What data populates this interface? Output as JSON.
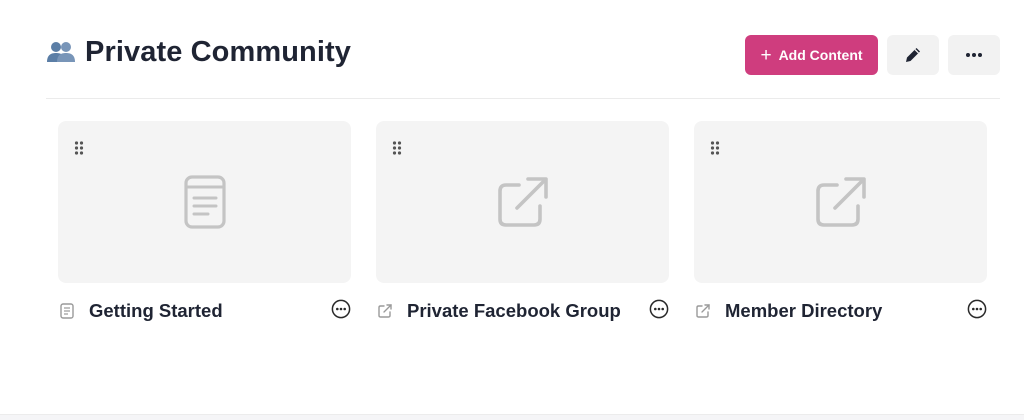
{
  "header": {
    "title": "Private Community",
    "title_icon": "people-icon",
    "add_label": "Add Content",
    "edit_icon": "pencil-icon",
    "more_icon": "ellipsis-icon"
  },
  "colors": {
    "accent": "#cf3d7e",
    "card_bg": "#f4f4f4",
    "icon_gray": "#c4c4c4",
    "title_icon_blue": "#5b7ea6"
  },
  "cards": [
    {
      "label": "Getting Started",
      "type_icon": "document-icon"
    },
    {
      "label": "Private Facebook Group",
      "type_icon": "external-link-icon"
    },
    {
      "label": "Member Directory",
      "type_icon": "external-link-icon"
    }
  ]
}
